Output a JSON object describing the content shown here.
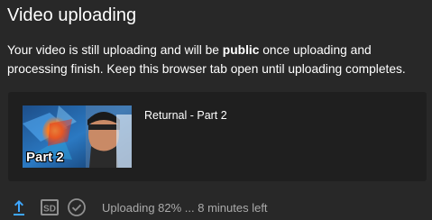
{
  "dialog": {
    "title": "Video uploading",
    "message": {
      "before": "Your video is still uploading and will be ",
      "emphasis": "public",
      "after": " once uploading and processing finish. Keep this browser tab open until uploading completes."
    }
  },
  "video": {
    "title": "Returnal - Part 2",
    "thumbnail_caption": "Part 2"
  },
  "footer": {
    "status": "Uploading 82% ... 8 minutes left",
    "upload_progress_percent": 82,
    "quality_badge": "SD",
    "icons": [
      "upload-icon",
      "sd-icon",
      "check-circle-icon"
    ]
  },
  "colors": {
    "background": "#282828",
    "card": "#1f1f1f",
    "accent": "#3ea6ff",
    "muted_icon": "#909090",
    "status_text": "#aaaaaa"
  }
}
